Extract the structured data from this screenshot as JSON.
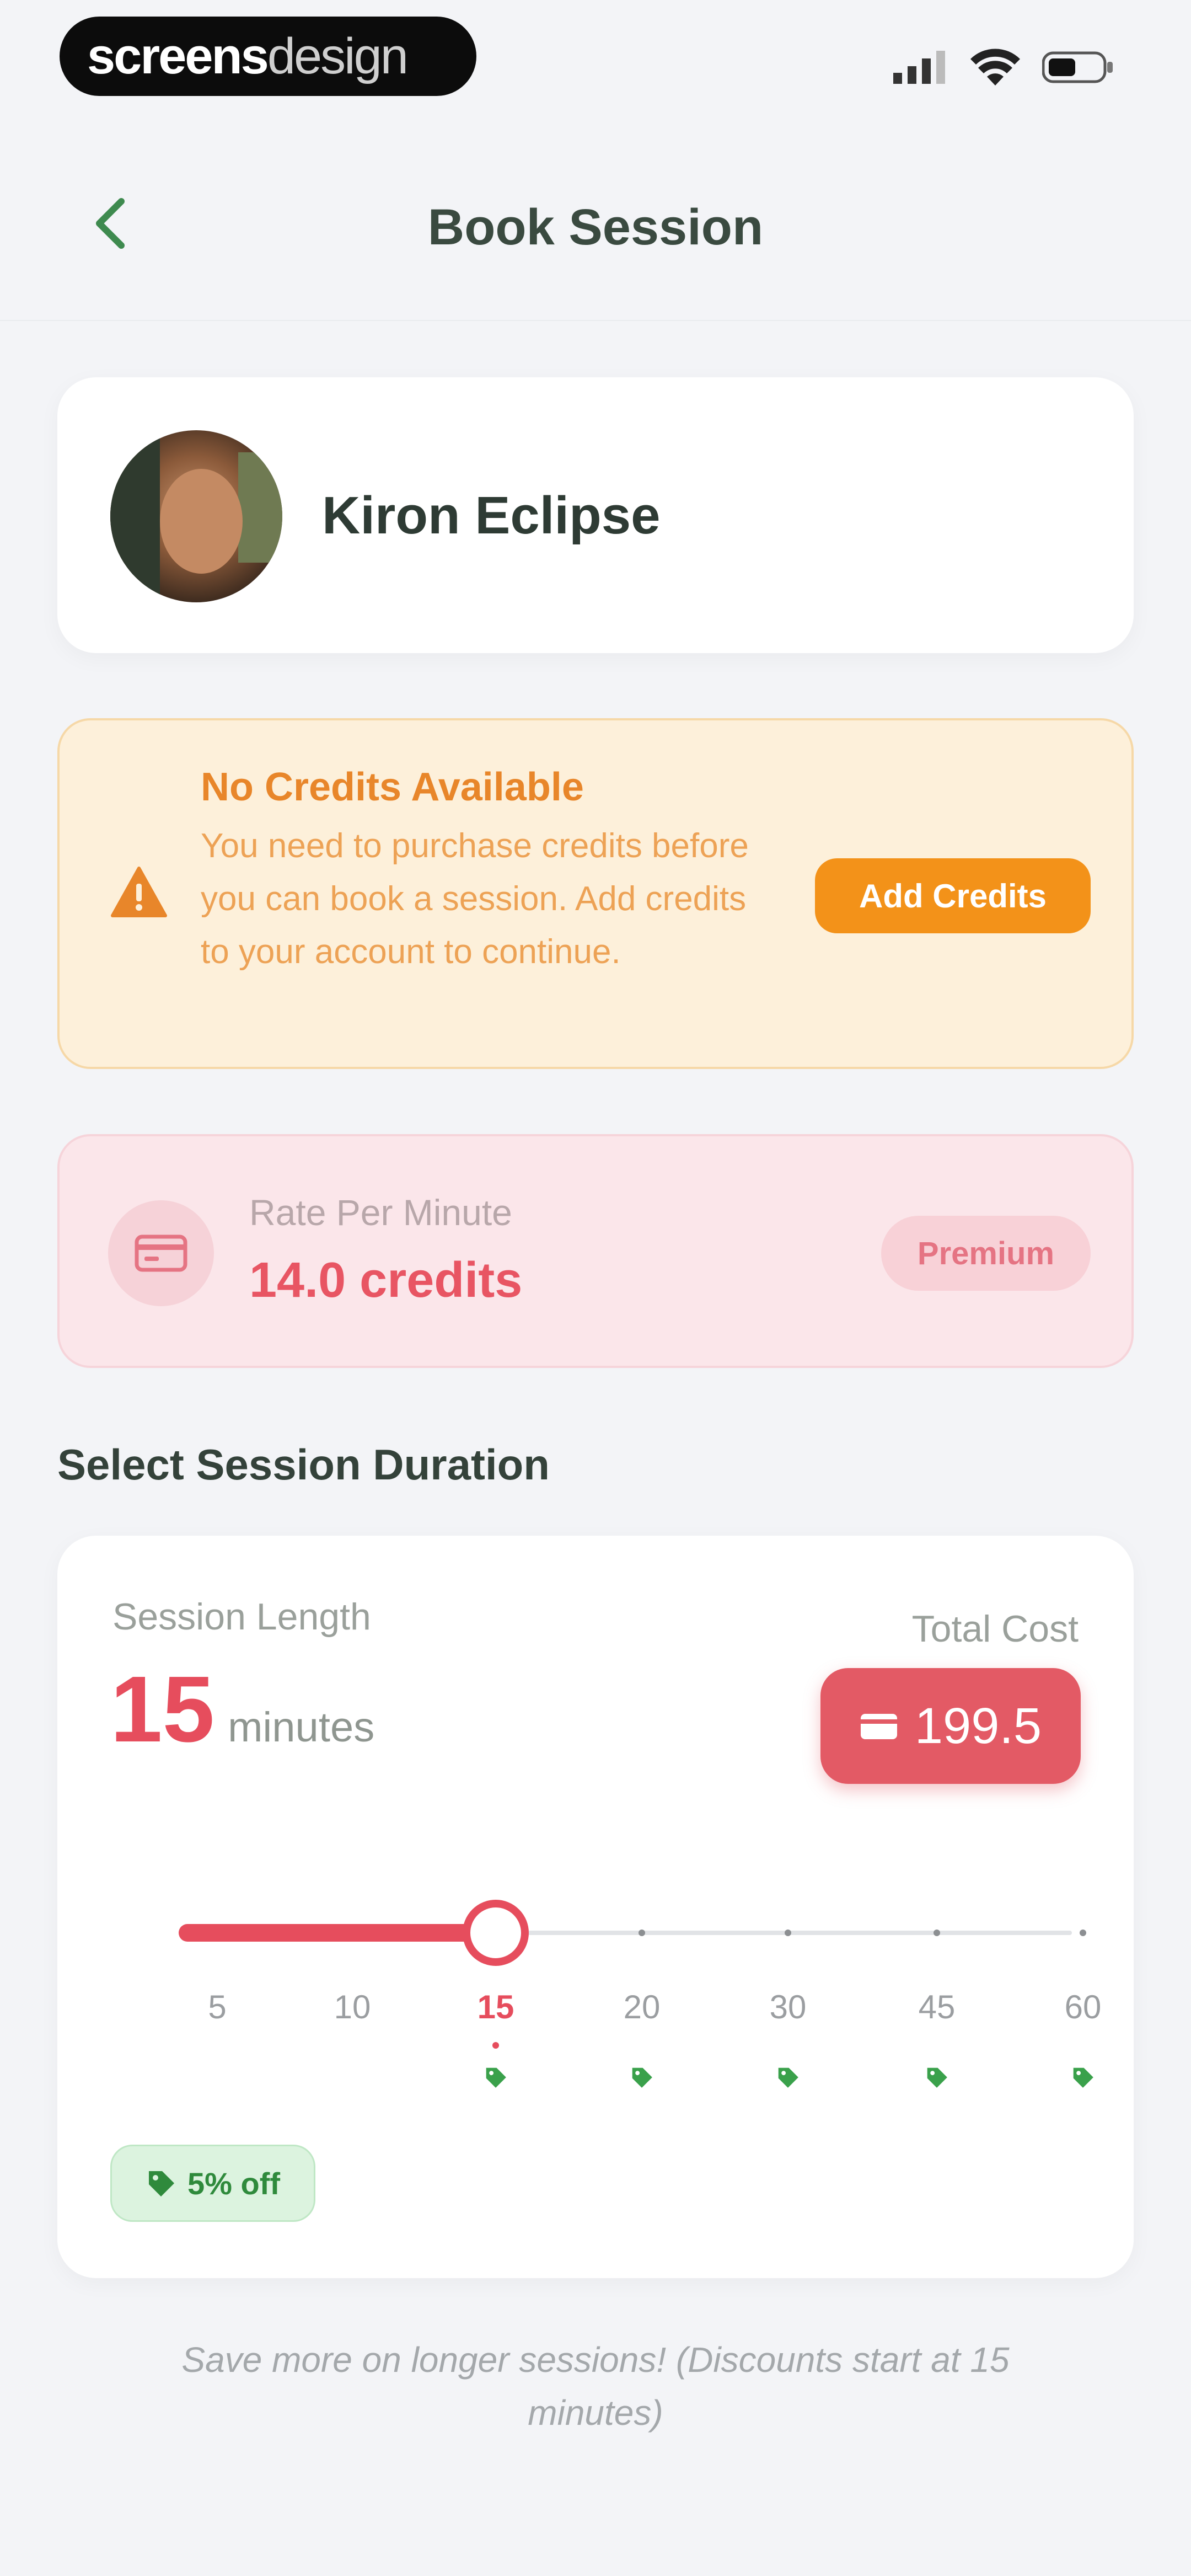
{
  "status_bar": {
    "brand_part1": "screens",
    "brand_part2": "design",
    "icons": [
      "signal-icon",
      "wifi-icon",
      "battery-icon"
    ]
  },
  "header": {
    "title": "Book Session",
    "back_icon": "chevron-left-icon"
  },
  "profile": {
    "name": "Kiron Eclipse"
  },
  "warning": {
    "title": "No Credits Available",
    "message": "You need to purchase credits before you can book a session. Add credits to your account to continue.",
    "button_label": "Add Credits",
    "icon": "warning-triangle-icon"
  },
  "rate": {
    "label": "Rate Per Minute",
    "value": "14.0 credits",
    "badge": "Premium",
    "icon": "wallet-icon"
  },
  "duration": {
    "section_title": "Select Session Duration",
    "session_label": "Session Length",
    "session_value": "15",
    "session_unit": "minutes",
    "total_label": "Total Cost",
    "total_value": "199.5",
    "options": [
      "5",
      "10",
      "15",
      "20",
      "30",
      "45",
      "60"
    ],
    "selected_index": 2,
    "discount_badge": "5% off"
  },
  "footer": {
    "note": "Save more on longer sessions! (Discounts start at 15 minutes)"
  },
  "colors": {
    "accent_red": "#e64d5d",
    "warning_orange": "#f39219",
    "discount_green": "#2f8a3c",
    "back_green": "#3e8a4f"
  }
}
